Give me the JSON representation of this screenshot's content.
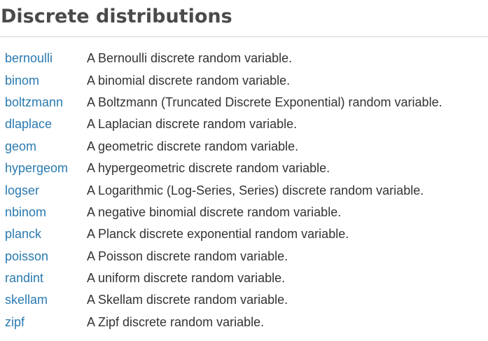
{
  "page": {
    "title": "Discrete distributions"
  },
  "colors": {
    "title": "#4a4a4a",
    "link": "#2a7ab0",
    "text": "#333333",
    "rule": "#d5d5d5"
  },
  "distributions": [
    {
      "name": "bernoulli",
      "description": "A Bernoulli discrete random variable."
    },
    {
      "name": "binom",
      "description": "A binomial discrete random variable."
    },
    {
      "name": "boltzmann",
      "description": "A Boltzmann (Truncated Discrete Exponential) random variable."
    },
    {
      "name": "dlaplace",
      "description": "A Laplacian discrete random variable."
    },
    {
      "name": "geom",
      "description": "A geometric discrete random variable."
    },
    {
      "name": "hypergeom",
      "description": "A hypergeometric discrete random variable."
    },
    {
      "name": "logser",
      "description": "A Logarithmic (Log-Series, Series) discrete random variable."
    },
    {
      "name": "nbinom",
      "description": "A negative binomial discrete random variable."
    },
    {
      "name": "planck",
      "description": "A Planck discrete exponential random variable."
    },
    {
      "name": "poisson",
      "description": "A Poisson discrete random variable."
    },
    {
      "name": "randint",
      "description": "A uniform discrete random variable."
    },
    {
      "name": "skellam",
      "description": "A Skellam discrete random variable."
    },
    {
      "name": "zipf",
      "description": "A Zipf discrete random variable."
    }
  ]
}
